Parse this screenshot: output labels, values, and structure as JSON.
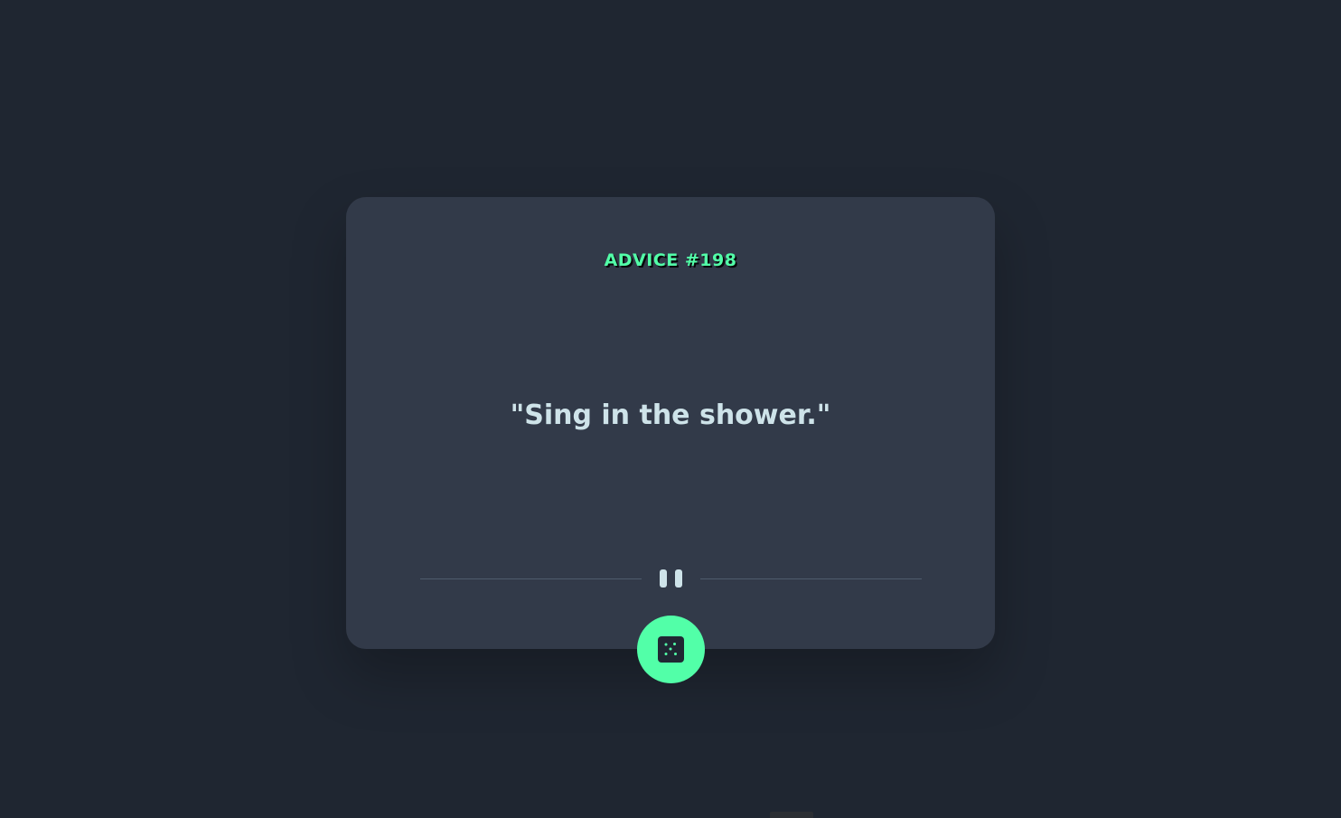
{
  "card": {
    "advice_label": "ADVICE #198",
    "quote": "\"Sing in the shower.\""
  },
  "divider": {
    "icon": "pause-icon"
  },
  "generate_button": {
    "icon": "dice-icon"
  },
  "colors": {
    "background": "#1f2631",
    "card": "#323a49",
    "accent": "#52ffa8",
    "quote_text": "#cee3e9",
    "divider_line": "#4f5b6c"
  }
}
